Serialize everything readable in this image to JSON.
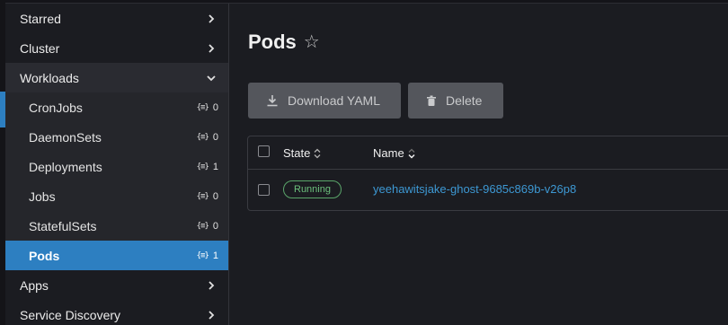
{
  "sidebar": {
    "groups_top": [
      {
        "label": "Starred"
      },
      {
        "label": "Cluster"
      }
    ],
    "workloads": {
      "label": "Workloads",
      "items": [
        {
          "label": "CronJobs",
          "count": "0"
        },
        {
          "label": "DaemonSets",
          "count": "0"
        },
        {
          "label": "Deployments",
          "count": "1"
        },
        {
          "label": "Jobs",
          "count": "0"
        },
        {
          "label": "StatefulSets",
          "count": "0"
        },
        {
          "label": "Pods",
          "count": "1"
        }
      ]
    },
    "groups_bottom": [
      {
        "label": "Apps"
      },
      {
        "label": "Service Discovery"
      }
    ]
  },
  "main": {
    "title": "Pods",
    "buttons": {
      "download_yaml": "Download YAML",
      "delete": "Delete"
    },
    "table": {
      "columns": {
        "state": "State",
        "name": "Name"
      },
      "rows": [
        {
          "state": "Running",
          "name": "yeehawitsjake-ghost-9685c869b-v26p8"
        }
      ]
    }
  },
  "colors": {
    "accent": "#2d7fc1",
    "link": "#3d98d3",
    "running": "#6cc07c"
  }
}
